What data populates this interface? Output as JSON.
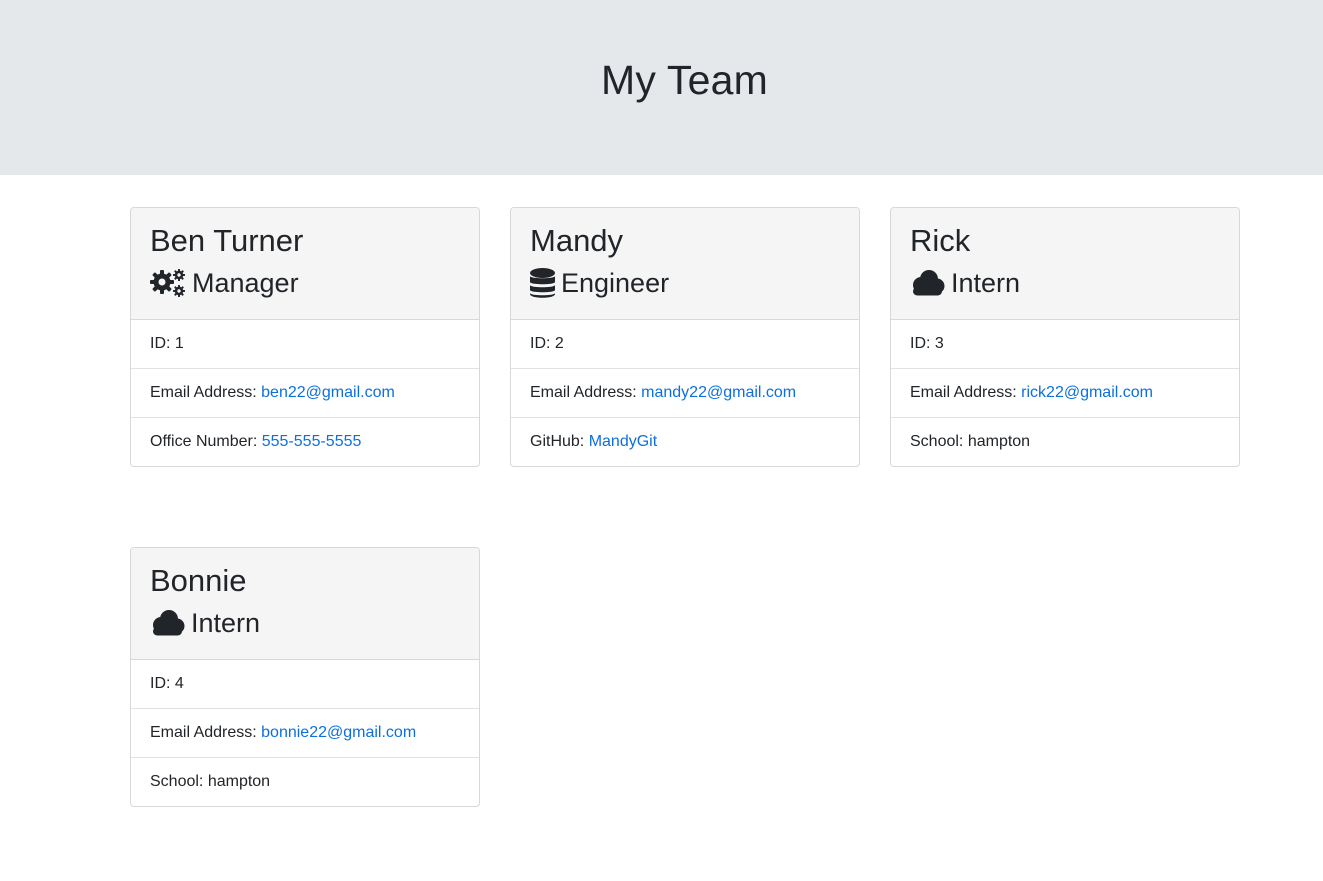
{
  "header": {
    "title": "My Team"
  },
  "cards": [
    {
      "name": "Ben Turner",
      "role": "Manager",
      "role_icon": "gears-icon",
      "id_label": "ID: 1",
      "email_label": "Email Address: ",
      "email": "ben22@gmail.com",
      "extra_label": "Office Number: ",
      "extra_value": "555-555-5555"
    },
    {
      "name": "Mandy",
      "role": "Engineer",
      "role_icon": "database-icon",
      "id_label": "ID: 2",
      "email_label": "Email Address: ",
      "email": "mandy22@gmail.com",
      "extra_label": "GitHub: ",
      "extra_value": "MandyGit"
    },
    {
      "name": "Rick",
      "role": "Intern",
      "role_icon": "cloud-icon",
      "id_label": "ID: 3",
      "email_label": "Email Address: ",
      "email": "rick22@gmail.com",
      "extra_label": "School: ",
      "extra_value": "hampton"
    },
    {
      "name": "Bonnie",
      "role": "Intern",
      "role_icon": "cloud-icon",
      "id_label": "ID: 4",
      "email_label": "Email Address: ",
      "email": "bonnie22@gmail.com",
      "extra_label": "School: ",
      "extra_value": "hampton"
    }
  ],
  "colors": {
    "header_bg": "#e5e8eb",
    "card_header_bg": "#f5f5f5",
    "link": "#0d6fde",
    "text": "#212529"
  }
}
